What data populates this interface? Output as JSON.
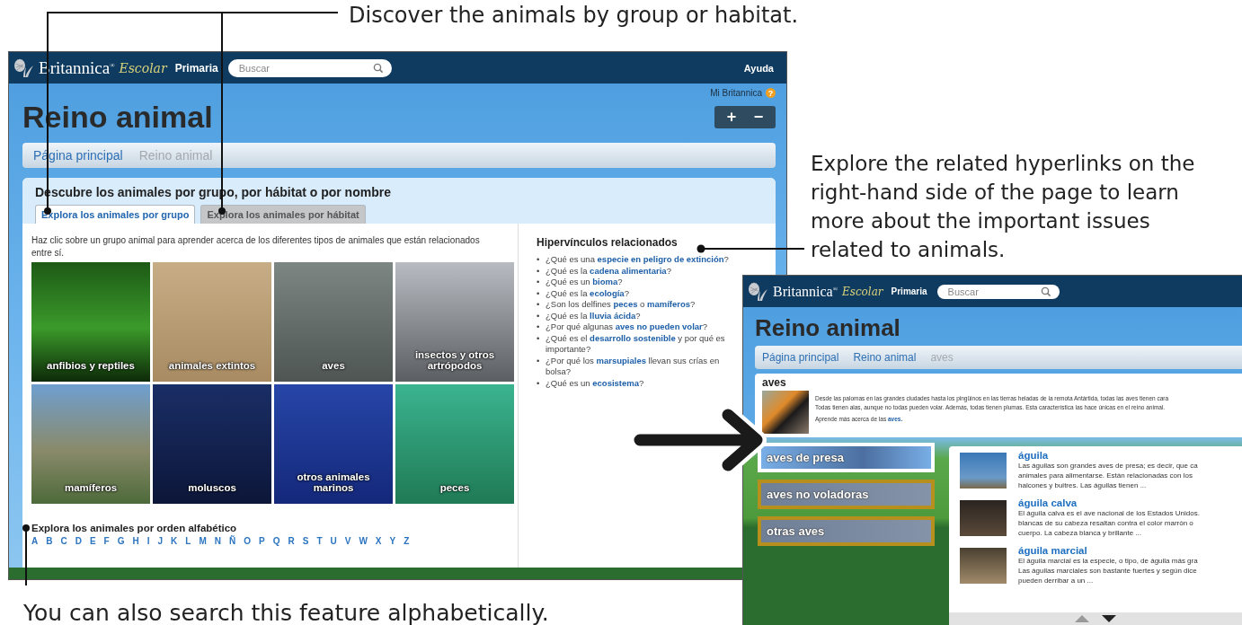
{
  "annotations": [
    {
      "text": "Discover the animals by group or habitat."
    },
    {
      "text": "Explore the related hyperlinks on the right-hand side of the page to learn more about the important issues related to animals."
    },
    {
      "text": "You can also search this feature alphabetically."
    }
  ],
  "main_screen": {
    "header": {
      "brand": "Britannica$^{®}$",
      "edition": "Escolar",
      "level": "Primaria",
      "search_placeholder": "Buscar",
      "help": "Ayuda"
    },
    "account": "Mi Britannica",
    "help_badge": "?",
    "zoom_buttons": [
      "+",
      "−"
    ],
    "title": "Reino animal",
    "breadcrumbs": [
      {
        "label": "Página principal",
        "current": false
      },
      {
        "label": "Reino animal",
        "current": true
      }
    ],
    "panel": {
      "heading": "Descubre los animales por grupo, por hábitat o por nombre",
      "tabs": [
        {
          "label": "Explora los animales por grupo",
          "selected": true
        },
        {
          "label": "Explora los animales por hábitat",
          "selected": false
        }
      ],
      "intro": "Haz clic sobre un grupo animal para aprender acerca de los diferentes tipos de animales que están relacionados entre sí.",
      "groups": [
        {
          "label": "anfibios y reptiles"
        },
        {
          "label": "animales extintos"
        },
        {
          "label": "aves"
        },
        {
          "label": "insectos y otros artrópodos"
        },
        {
          "label": "mamíferos"
        },
        {
          "label": "moluscos"
        },
        {
          "label": "otros animales marinos"
        },
        {
          "label": "peces"
        }
      ],
      "alpha_heading": "Explora los animales por orden alfabético",
      "letters": [
        "A",
        "B",
        "C",
        "D",
        "E",
        "F",
        "G",
        "H",
        "I",
        "J",
        "K",
        "L",
        "M",
        "N",
        "Ñ",
        "O",
        "P",
        "Q",
        "R",
        "S",
        "T",
        "U",
        "V",
        "W",
        "X",
        "Y",
        "Z"
      ]
    },
    "related": {
      "heading": "Hipervínculos relacionados",
      "items": [
        {
          "bullet": "•",
          "text": "¿Qué es una **especie en peligro de extinción**?"
        },
        {
          "bullet": "•",
          "text": "¿Qué es la **cadena alimentaria**?"
        },
        {
          "bullet": "•",
          "text": "¿Qué es un **bioma**?"
        },
        {
          "bullet": "•",
          "text": "¿Qué es la **ecología**?"
        },
        {
          "bullet": "•",
          "text": "¿Son los delfines **peces** o **mamíferos**?"
        },
        {
          "bullet": "•",
          "text": "¿Qué es la **lluvia ácida**?"
        },
        {
          "bullet": "•",
          "text": "¿Por qué algunas **aves no pueden volar**?"
        },
        {
          "bullet": "•",
          "text": "¿Qué es el **desarrollo sostenible** y por qué es importante?"
        },
        {
          "bullet": "•",
          "text": "¿Por qué los **marsupiales** llevan sus crías en bolsa?"
        },
        {
          "bullet": "•",
          "text": "¿Qué es un **ecosistema**?"
        }
      ]
    }
  },
  "detail_screen": {
    "header": {
      "brand": "Britannica$^{®}$",
      "edition": "Escolar",
      "level": "Primaria",
      "search_placeholder": "Buscar"
    },
    "title": "Reino animal",
    "breadcrumbs": [
      {
        "label": "Página principal",
        "current": false
      },
      {
        "label": "Reino animal",
        "current": false
      },
      {
        "label": "aves",
        "current": true
      }
    ],
    "intro": {
      "heading": "aves",
      "text": "Desde las palomas en las grandes ciudades hasta los pingüinos en las tierras heladas de la remota Antártida, todas las aves tienen cara\nTodas tienen alas, aunque no todas pueden volar. Además, todas tienen plumas. Esta característica las hace únicas en el reino animal.",
      "more": "Aprende más acerca de las **aves.**"
    },
    "categories": [
      {
        "label": "aves de presa",
        "selected": true
      },
      {
        "label": "aves no voladoras",
        "selected": false
      },
      {
        "label": "otras aves",
        "selected": false
      }
    ],
    "results": [
      {
        "title": "águila",
        "text": "Las águilas son grandes aves de presa; es decir, que ca\nanimales para alimentarse. Están relacionadas con los\nhalcones y buitres. Las águilas tienen ..."
      },
      {
        "title": "águila calva",
        "text": "El águila calva es el ave nacional de los Estados Unidos.\nblancas de su cabeza resaltan contra el color marrón o\ncuerpo. La cabeza blanca y brillante ..."
      },
      {
        "title": "águila marcial",
        "text": "El águila marcial es la especie, o tipo, de águila más gra\nLas águilas marciales son bastante fuertes y según dice\npueden derribar a un ..."
      }
    ]
  }
}
